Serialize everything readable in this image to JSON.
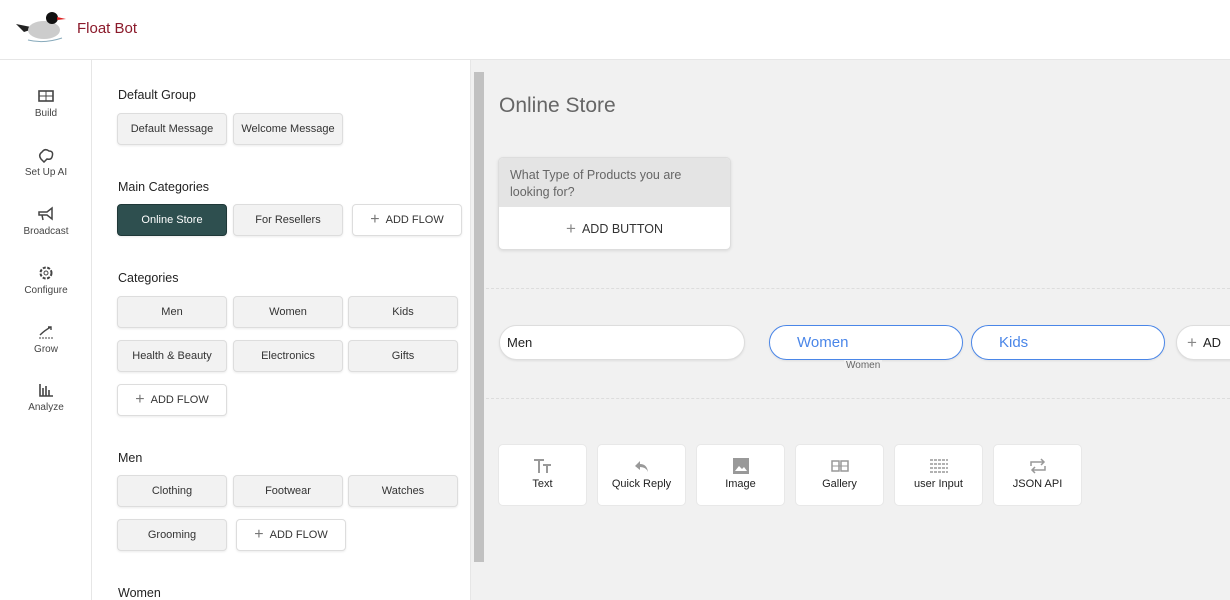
{
  "app": {
    "brand": "Float Bot"
  },
  "sidebar": {
    "items": [
      {
        "label": "Build",
        "icon": "build-icon"
      },
      {
        "label": "Set Up AI",
        "icon": "ai-icon"
      },
      {
        "label": "Broadcast",
        "icon": "megaphone-icon"
      },
      {
        "label": "Configure",
        "icon": "gear-icon"
      },
      {
        "label": "Grow",
        "icon": "grow-icon"
      },
      {
        "label": "Analyze",
        "icon": "chart-icon"
      }
    ]
  },
  "panel": {
    "default_group": {
      "title": "Default Group",
      "items": [
        "Default Message",
        "Welcome Message"
      ]
    },
    "main_categories": {
      "title": "Main Categories",
      "items": [
        "Online Store",
        "For Resellers"
      ],
      "add": "ADD FLOW"
    },
    "categories": {
      "title": "Categories",
      "items": [
        "Men",
        "Women",
        "Kids",
        "Health & Beauty",
        "Electronics",
        "Gifts"
      ],
      "add": "ADD FLOW"
    },
    "men": {
      "title": "Men",
      "items": [
        "Clothing",
        "Footwear",
        "Watches",
        "Grooming"
      ],
      "add": "ADD FLOW"
    },
    "women": {
      "title": "Women"
    }
  },
  "canvas": {
    "title": "Online Store",
    "message": "What Type of Products you are looking for?",
    "add_button": "ADD BUTTON",
    "quick_replies": [
      "Men",
      "Women",
      "Kids"
    ],
    "add_partial": "AD",
    "tooltip": "Women",
    "tools": [
      "Text",
      "Quick Reply",
      "Image",
      "Gallery",
      "user Input",
      "JSON API"
    ]
  },
  "colors": {
    "active": "#2e4f4f",
    "accent": "#4a86e8",
    "brand": "#8b1a2b"
  }
}
